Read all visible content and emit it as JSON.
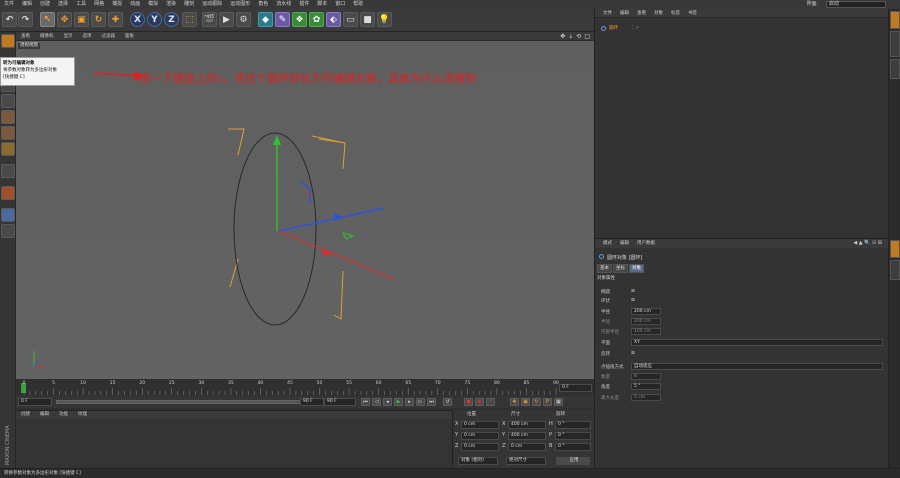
{
  "menubar": {
    "items": [
      "文件",
      "编辑",
      "创建",
      "选择",
      "工具",
      "网格",
      "捕捉",
      "动画",
      "模拟",
      "渲染",
      "雕刻",
      "运动跟踪",
      "运动图形",
      "角色",
      "流水线",
      "插件",
      "脚本",
      "窗口",
      "帮助"
    ],
    "layout_label": "界面:",
    "layout_value": "启动"
  },
  "toolbar": {
    "axis_x": "X",
    "axis_y": "Y",
    "axis_z": "Z"
  },
  "viewport": {
    "menu": [
      "查看",
      "摄像机",
      "显示",
      "选项",
      "过滤器",
      "面板"
    ],
    "label": "透视视图"
  },
  "tooltip": {
    "title": "转为可编辑对象",
    "line2": "将参数对象转为多边形对象",
    "line3": "[快捷键 C]"
  },
  "annotation": "按一下键盘上的c，将这个圆环转化为可编辑对象，具体为什么请搜狗",
  "timeline": {
    "ticks": [
      "0",
      "5",
      "10",
      "15",
      "20",
      "25",
      "30",
      "35",
      "40",
      "45",
      "50",
      "55",
      "60",
      "65",
      "70",
      "75",
      "80",
      "85",
      "90"
    ],
    "current_frame": "0 F",
    "start": "0 F",
    "end": "90 F",
    "end2": "90 F"
  },
  "material": {
    "menu": [
      "创建",
      "编辑",
      "功能",
      "纹理"
    ]
  },
  "coords": {
    "headers": [
      "位置",
      "尺寸",
      "旋转"
    ],
    "rows": [
      {
        "axis": "X",
        "pos": "0 cm",
        "size_axis": "X",
        "size": "400 cm",
        "rot_axis": "H",
        "rot": "0 °"
      },
      {
        "axis": "Y",
        "pos": "0 cm",
        "size_axis": "Y",
        "size": "400 cm",
        "rot_axis": "P",
        "rot": "0 °"
      },
      {
        "axis": "Z",
        "pos": "0 cm",
        "size_axis": "Z",
        "size": "0 cm",
        "rot_axis": "B",
        "rot": "0 °"
      }
    ],
    "mode_select": "对象 (相对)",
    "size_select": "绝对尺寸",
    "apply": "应用"
  },
  "status": "转换参数对象为多边形对象 [快捷键 C]",
  "objmgr": {
    "menu": [
      "文件",
      "编辑",
      "查看",
      "对象",
      "标签",
      "书签"
    ],
    "object_name": "圆环"
  },
  "attrmgr": {
    "menu": [
      "模式",
      "编辑",
      "用户数据"
    ],
    "title": "圆环对象 [圆环]",
    "tabs": [
      "基本",
      "坐标",
      "对象"
    ],
    "section": "对象属性",
    "props": [
      {
        "label": "椭圆",
        "value": "",
        "check": "⊠"
      },
      {
        "label": "环状",
        "value": "",
        "check": "⊠"
      },
      {
        "label": "半径",
        "value": "200 cm",
        "check": ""
      },
      {
        "label": "半径",
        "value": "200 cm",
        "check": ""
      },
      {
        "label": "内部半径",
        "value": "100 cm",
        "check": ""
      },
      {
        "label": "平面",
        "value": "XY",
        "check": ""
      },
      {
        "label": "反转",
        "value": "",
        "check": "⊠"
      },
      {
        "label": "点插值方式",
        "value": "自动适应",
        "check": ""
      },
      {
        "label": "数量",
        "value": "8",
        "check": ""
      },
      {
        "label": "角度",
        "value": "5 °",
        "check": ""
      },
      {
        "label": "最大长度",
        "value": "5 cm",
        "check": ""
      }
    ]
  },
  "colors": {
    "background": "#5f5f5f",
    "annotation": "#e02020",
    "accent_orange": "#f0a030",
    "x_axis": "#e03030",
    "y_axis": "#30c030",
    "z_axis": "#3050e0"
  }
}
